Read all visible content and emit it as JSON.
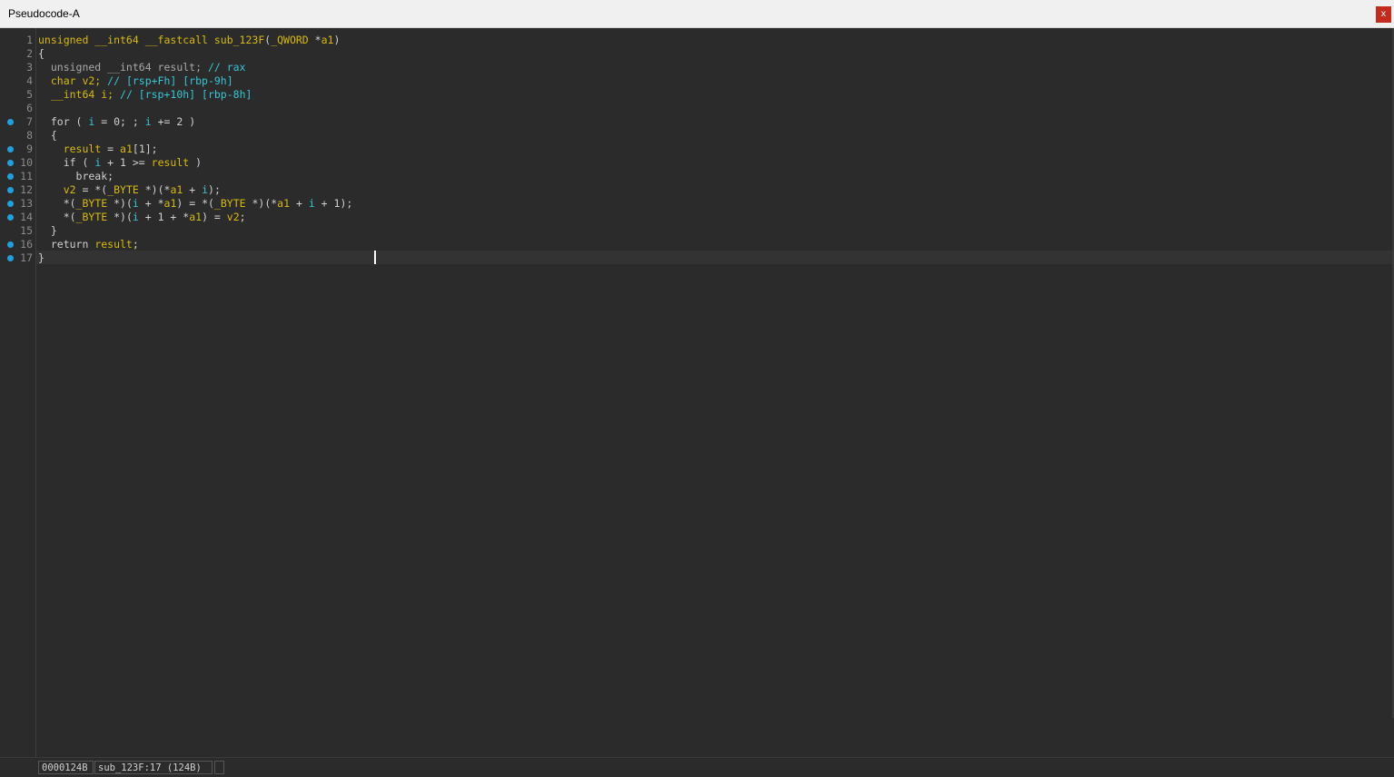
{
  "window": {
    "title": "Pseudocode-A",
    "close_label": "x"
  },
  "colors": {
    "keyword": "#d7ba0f",
    "identifier": "#35c7d4",
    "text": "#d0d0d0",
    "breakpoint_dot": "#1ea2df",
    "close_button": "#c42b1c"
  },
  "gutter": {
    "lines": [
      {
        "n": "1",
        "dot": false
      },
      {
        "n": "2",
        "dot": false
      },
      {
        "n": "3",
        "dot": false
      },
      {
        "n": "4",
        "dot": false
      },
      {
        "n": "5",
        "dot": false
      },
      {
        "n": "6",
        "dot": false
      },
      {
        "n": "7",
        "dot": true
      },
      {
        "n": "8",
        "dot": false
      },
      {
        "n": "9",
        "dot": true
      },
      {
        "n": "10",
        "dot": true
      },
      {
        "n": "11",
        "dot": true
      },
      {
        "n": "12",
        "dot": true
      },
      {
        "n": "13",
        "dot": true
      },
      {
        "n": "14",
        "dot": true
      },
      {
        "n": "15",
        "dot": false
      },
      {
        "n": "16",
        "dot": true
      },
      {
        "n": "17",
        "dot": true
      }
    ]
  },
  "code": {
    "lines": [
      [
        [
          "kw",
          "unsigned __int64 __fastcall sub_123F"
        ],
        [
          "wh",
          "("
        ],
        [
          "kw",
          "_QWORD"
        ],
        [
          "wh",
          " *"
        ],
        [
          "kw",
          "a1"
        ],
        [
          "wh",
          ")"
        ]
      ],
      [
        [
          "wh",
          "{"
        ]
      ],
      [
        [
          "gr",
          "  unsigned __int64 result; "
        ],
        [
          "cy",
          "// rax"
        ]
      ],
      [
        [
          "kw",
          "  char v2; "
        ],
        [
          "cy",
          "// [rsp+Fh] [rbp-9h]"
        ]
      ],
      [
        [
          "kw",
          "  __int64 i; "
        ],
        [
          "cy",
          "// [rsp+10h] [rbp-8h]"
        ]
      ],
      [
        [
          "wh",
          ""
        ]
      ],
      [
        [
          "wh",
          "  for ( "
        ],
        [
          "cy",
          "i"
        ],
        [
          "wh",
          " = 0; ; "
        ],
        [
          "cy",
          "i"
        ],
        [
          "wh",
          " += 2 )"
        ]
      ],
      [
        [
          "wh",
          "  {"
        ]
      ],
      [
        [
          "wh",
          "    "
        ],
        [
          "kw",
          "result"
        ],
        [
          "wh",
          " = "
        ],
        [
          "kw",
          "a1"
        ],
        [
          "wh",
          "[1];"
        ]
      ],
      [
        [
          "wh",
          "    if ( "
        ],
        [
          "cy",
          "i"
        ],
        [
          "wh",
          " + 1 >= "
        ],
        [
          "kw",
          "result"
        ],
        [
          "wh",
          " )"
        ]
      ],
      [
        [
          "wh",
          "      break;"
        ]
      ],
      [
        [
          "wh",
          "    "
        ],
        [
          "kw",
          "v2"
        ],
        [
          "wh",
          " = *("
        ],
        [
          "kw",
          "_BYTE"
        ],
        [
          "wh",
          " *)(*"
        ],
        [
          "kw",
          "a1"
        ],
        [
          "wh",
          " + "
        ],
        [
          "cy",
          "i"
        ],
        [
          "wh",
          ");"
        ]
      ],
      [
        [
          "wh",
          "    *("
        ],
        [
          "kw",
          "_BYTE"
        ],
        [
          "wh",
          " *)("
        ],
        [
          "cy",
          "i"
        ],
        [
          "wh",
          " + *"
        ],
        [
          "kw",
          "a1"
        ],
        [
          "wh",
          ") = *("
        ],
        [
          "kw",
          "_BYTE"
        ],
        [
          "wh",
          " *)(*"
        ],
        [
          "kw",
          "a1"
        ],
        [
          "wh",
          " + "
        ],
        [
          "cy",
          "i"
        ],
        [
          "wh",
          " + 1);"
        ]
      ],
      [
        [
          "wh",
          "    *("
        ],
        [
          "kw",
          "_BYTE"
        ],
        [
          "wh",
          " *)("
        ],
        [
          "cy",
          "i"
        ],
        [
          "wh",
          " + 1 + *"
        ],
        [
          "kw",
          "a1"
        ],
        [
          "wh",
          ") = "
        ],
        [
          "kw",
          "v2"
        ],
        [
          "wh",
          ";"
        ]
      ],
      [
        [
          "wh",
          "  }"
        ]
      ],
      [
        [
          "wh",
          "  return "
        ],
        [
          "kw",
          "result"
        ],
        [
          "wh",
          ";"
        ]
      ],
      [
        [
          "wh",
          "}"
        ]
      ]
    ]
  },
  "status": {
    "address": "0000124B",
    "location": "sub_123F:17 (124B)",
    "extra": ""
  }
}
